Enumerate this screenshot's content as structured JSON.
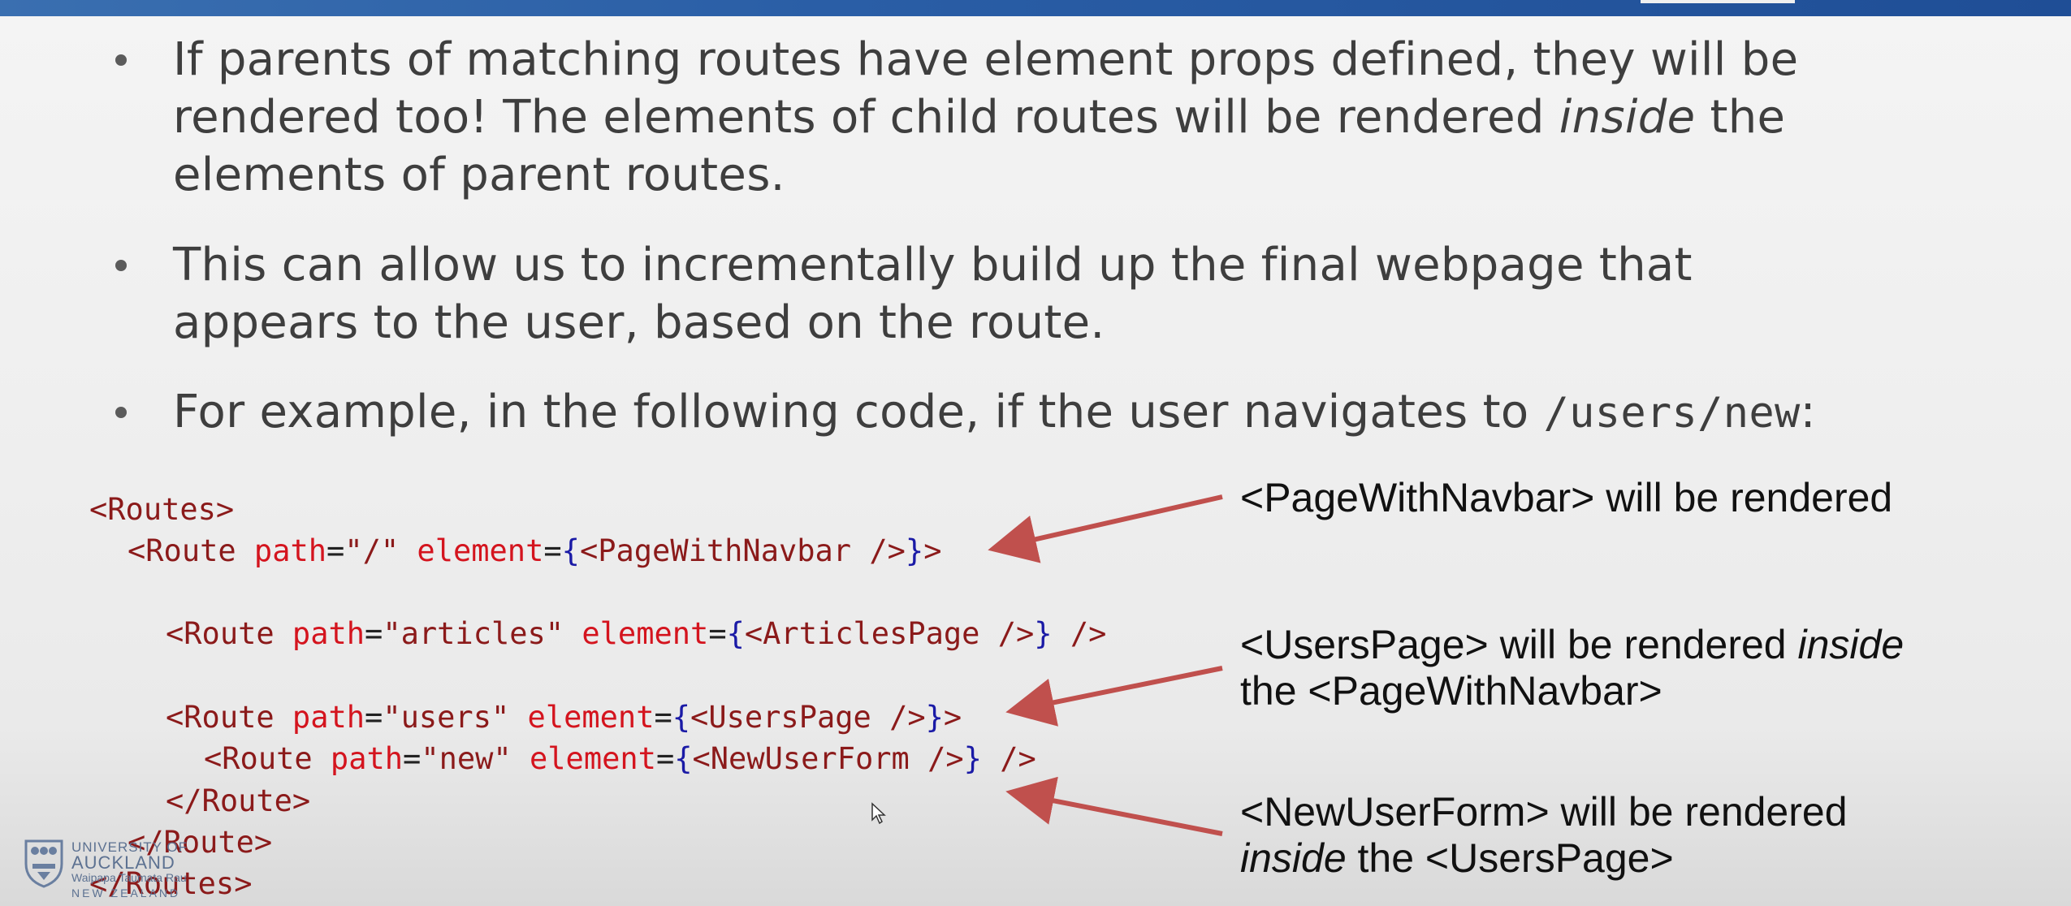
{
  "bullets": [
    {
      "line1": "If parents of matching routes have element props defined, they will be",
      "line2_pre": "rendered too! The elements of child routes will be rendered ",
      "line2_em": "inside",
      "line2_post": " the",
      "line3": "elements of parent routes."
    },
    {
      "line1": "This can allow us to incrementally build up the final webpage that",
      "line2": "appears to the user, based on the route."
    },
    {
      "text": "For example, in the following code, if the user navigates to ",
      "code": "/users/new",
      "suffix": ":"
    }
  ],
  "code": {
    "l1_tag": "<Routes>",
    "l2_tag": "<Route",
    "l2_attr1": " path",
    "l2_val1": "\"/\"",
    "l2_attr2": " element",
    "l2_comp": "<PageWithNavbar />",
    "l2_end": ">",
    "l3_tag": "<Route",
    "l3_attr1": " path",
    "l3_val1": "\"articles\"",
    "l3_attr2": " element",
    "l3_comp": "<ArticlesPage />",
    "l3_end": " />",
    "l4_tag": "<Route",
    "l4_attr1": " path",
    "l4_val1": "\"users\"",
    "l4_attr2": " element",
    "l4_comp": "<UsersPage />",
    "l4_end": ">",
    "l5_tag": "<Route",
    "l5_attr1": " path",
    "l5_val1": "\"new\"",
    "l5_attr2": " element",
    "l5_comp": "<NewUserForm />",
    "l5_end": " />",
    "l6": "</Route>",
    "l7": "</Route>",
    "l8": "</Routes>",
    "eq": "=",
    "open_brace": "{",
    "close_brace": "}"
  },
  "notes": {
    "n1": "<PageWithNavbar> will be rendered",
    "n2_pre": "<UsersPage> will be rendered ",
    "n2_em": "inside",
    "n2_line2": "the <PageWithNavbar>",
    "n3_line1": "<NewUserForm> will be rendered",
    "n3_em": "inside",
    "n3_post": " the <UsersPage>"
  },
  "logo": {
    "line1": "UNIVERSITY OF",
    "line2": "AUCKLAND",
    "line3": "Waipapa Taumata Rau",
    "line4": "NEW ZEALAND"
  },
  "colors": {
    "accent_bar": "#2a5ea6",
    "arrow": "#c0504d",
    "code_tag": "#8b1a1a",
    "code_attr": "#d4141e",
    "code_brace": "#1a1aa6"
  }
}
